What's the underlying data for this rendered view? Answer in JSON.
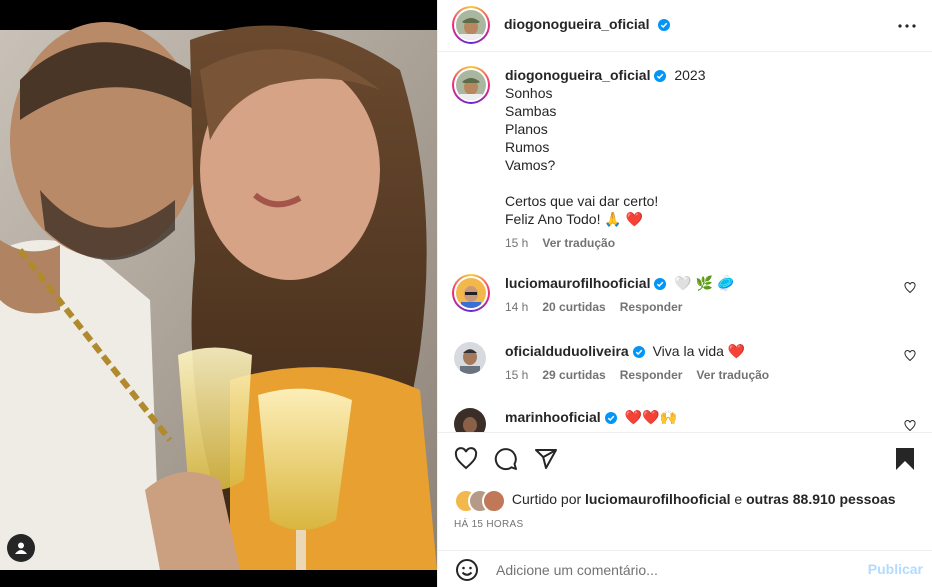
{
  "post": {
    "username": "diogonogueira_oficial",
    "verified": true,
    "more_icon": "more-horizontal-icon",
    "tag_icon": "user-tag-icon"
  },
  "caption": {
    "username": "diogonogueira_oficial",
    "lines": [
      "2023",
      "Sonhos",
      "Sambas",
      "Planos",
      "Rumos",
      "Vamos?",
      "",
      "Certos que vai dar certo!",
      "Feliz Ano Todo! 🙏 ❤️"
    ],
    "time": "15 h",
    "translate": "Ver tradução"
  },
  "comments": [
    {
      "username": "luciomaurofilhooficial",
      "text": "🤍 🌿 🥏",
      "time": "14 h",
      "likes": "20 curtidas",
      "reply": "Responder",
      "translate": ""
    },
    {
      "username": "oficialduduoliveira",
      "text": "Viva la vida ❤️",
      "time": "15 h",
      "likes": "29 curtidas",
      "reply": "Responder",
      "translate": "Ver tradução"
    },
    {
      "username": "marinhooficial",
      "text": "❤️❤️🙌",
      "time": "",
      "likes": "",
      "reply": "",
      "translate": ""
    }
  ],
  "actions": {
    "like_icon": "heart-icon",
    "comment_icon": "comment-icon",
    "share_icon": "send-icon",
    "save_icon": "bookmark-icon"
  },
  "likes": {
    "prefix": "Curtido por",
    "user": "luciomaurofilhooficial",
    "middle": "e",
    "others": "outras 88.910 pessoas"
  },
  "timestamp": "HÁ 15 HORAS",
  "add_comment": {
    "placeholder": "Adicione um comentário...",
    "publish": "Publicar",
    "emoji_icon": "emoji-icon"
  },
  "colors": {
    "text": "#262626",
    "muted": "#737373",
    "verified": "#0095f6",
    "publish_disabled": "#b3dbff",
    "heart_red": "#ed4956"
  }
}
